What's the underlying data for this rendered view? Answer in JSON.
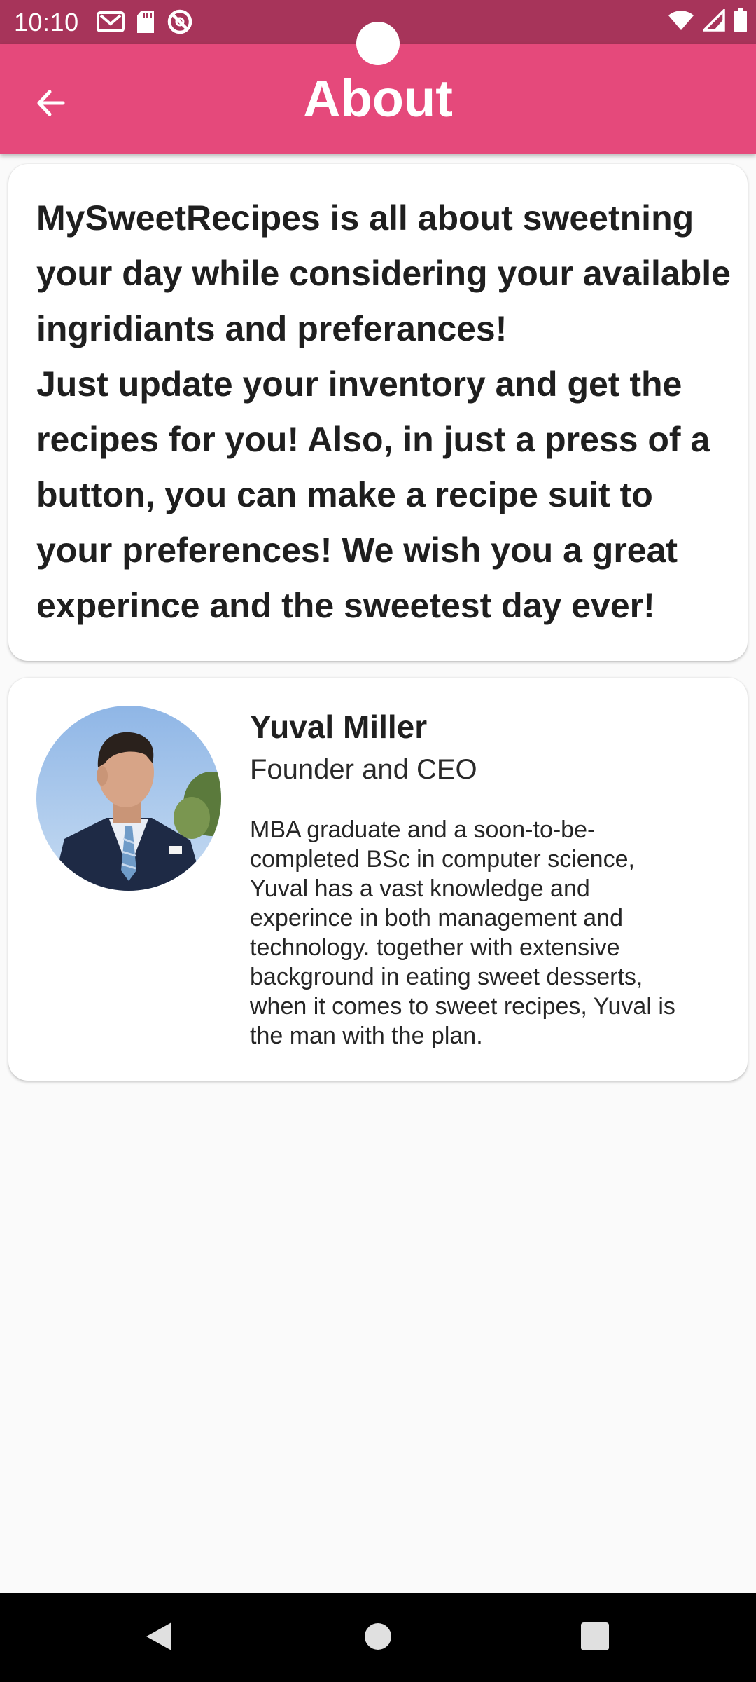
{
  "status_bar": {
    "time": "10:10",
    "left_icons": [
      "gmail-icon",
      "sd-card-icon",
      "do-not-disturb-icon"
    ],
    "right_icons": [
      "wifi-icon",
      "cell-signal-icon",
      "battery-icon"
    ],
    "color": "#a7345a"
  },
  "app_bar": {
    "title": "About",
    "back_icon": "arrow-back-icon",
    "color": "#e5497b"
  },
  "about": {
    "lines": [
      "MySweetRecipes is all about sweetning",
      "your day while considering your available",
      "ingridiants and preferances!",
      "Just update your inventory and get the",
      "recipes for you! Also, in just a press of a",
      "button, you can make a recipe suit to",
      "your preferences! We wish you a great",
      "experince and the sweetest day ever!"
    ]
  },
  "person": {
    "name": "Yuval Miller",
    "role": "Founder and CEO",
    "bio_lines": [
      "MBA graduate and a soon-to-be-",
      "completed BSc in computer science,",
      "Yuval has a vast knowledge and",
      "experince in both management and",
      "technology. together with extensive",
      "background in eating sweet desserts,",
      "when it comes to sweet recipes, Yuval is",
      "the man with the plan."
    ],
    "avatar_icon": "profile-photo"
  },
  "nav_bar": {
    "buttons": [
      "back-triangle-icon",
      "home-circle-icon",
      "recents-square-icon"
    ]
  }
}
